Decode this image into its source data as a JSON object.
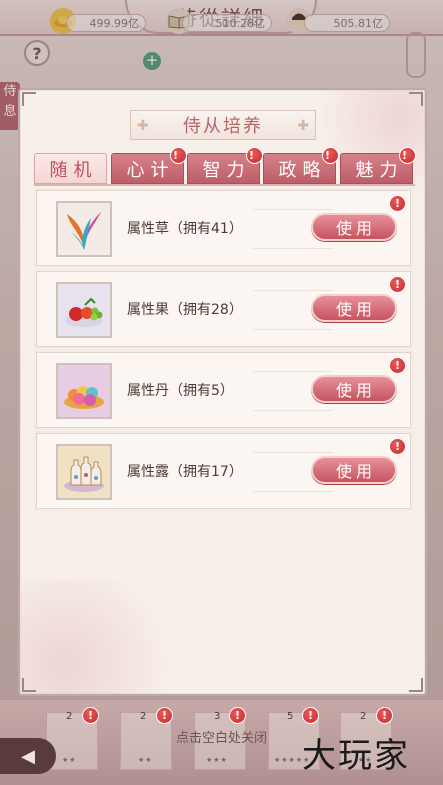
{
  "screen_title": "侍從詳細",
  "side_tab_label": "侍息",
  "resources": [
    {
      "icon": "gold-ingot-icon",
      "value": "499.99亿"
    },
    {
      "icon": "book-icon",
      "value": "510.28亿"
    },
    {
      "icon": "soldier-icon",
      "value": "505.81亿"
    }
  ],
  "panel": {
    "title": "侍从培养",
    "tabs": [
      {
        "label": "随机",
        "active": true,
        "badge": false
      },
      {
        "label": "心计",
        "active": false,
        "badge": true
      },
      {
        "label": "智力",
        "active": false,
        "badge": true
      },
      {
        "label": "政略",
        "active": false,
        "badge": true
      },
      {
        "label": "魅力",
        "active": false,
        "badge": true
      }
    ],
    "badge_text": "!",
    "items": [
      {
        "name": "属性草（拥有41）",
        "icon": "herb-icon",
        "button": "使用"
      },
      {
        "name": "属性果（拥有28）",
        "icon": "fruit-icon",
        "button": "使用"
      },
      {
        "name": "属性丹（拥有5）",
        "icon": "pill-icon",
        "button": "使用"
      },
      {
        "name": "属性露（拥有17）",
        "icon": "dew-bottle-icon",
        "button": "使用"
      }
    ]
  },
  "bottom": {
    "close_hint": "点击空白处关闭",
    "slots": [
      {
        "count": "2",
        "stars": "★★"
      },
      {
        "count": "2",
        "stars": "★★"
      },
      {
        "count": "3",
        "stars": "★★★"
      },
      {
        "count": "5",
        "stars": "★★★★★"
      },
      {
        "count": "2",
        "stars": "★★"
      }
    ]
  },
  "watermark": "大玩家",
  "colors": {
    "accent": "#c5545f",
    "tab_inactive": "#bd5d68",
    "panel_bg": "#f7efe9",
    "badge": "#c62a2f"
  }
}
